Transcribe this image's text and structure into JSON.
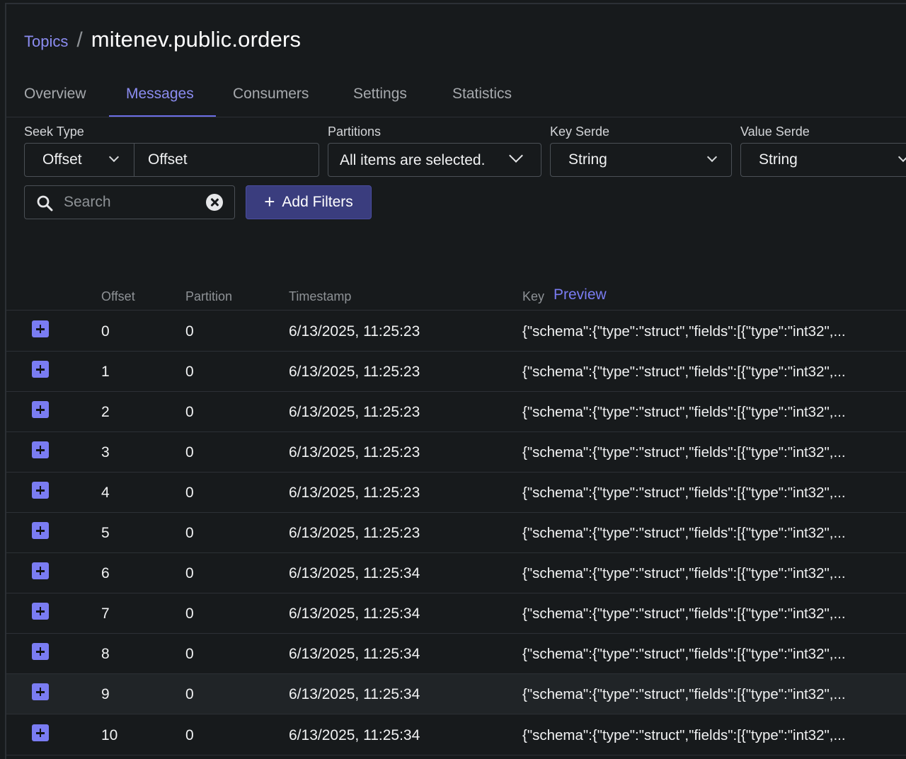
{
  "breadcrumb": {
    "parent": "Topics",
    "separator": "/",
    "current": "mitenev.public.orders"
  },
  "tabs": [
    {
      "label": "Overview"
    },
    {
      "label": "Messages",
      "active": true
    },
    {
      "label": "Consumers"
    },
    {
      "label": "Settings"
    },
    {
      "label": "Statistics"
    }
  ],
  "filters": {
    "seek_type": {
      "label": "Seek Type",
      "value": "Offset",
      "input_placeholder": "Offset"
    },
    "partitions": {
      "label": "Partitions",
      "value": "All items are selected."
    },
    "key_serde": {
      "label": "Key Serde",
      "value": "String"
    },
    "value_serde": {
      "label": "Value Serde",
      "value": "String"
    },
    "search": {
      "placeholder": "Search"
    },
    "add_filters_label": "Add Filters"
  },
  "table": {
    "headers": {
      "offset": "Offset",
      "partition": "Partition",
      "timestamp": "Timestamp",
      "key": "Key",
      "preview": "Preview"
    },
    "rows": [
      {
        "offset": "0",
        "partition": "0",
        "timestamp": "6/13/2025, 11:25:23",
        "key": "{\"schema\":{\"type\":\"struct\",\"fields\":[{\"type\":\"int32\",..."
      },
      {
        "offset": "1",
        "partition": "0",
        "timestamp": "6/13/2025, 11:25:23",
        "key": "{\"schema\":{\"type\":\"struct\",\"fields\":[{\"type\":\"int32\",..."
      },
      {
        "offset": "2",
        "partition": "0",
        "timestamp": "6/13/2025, 11:25:23",
        "key": "{\"schema\":{\"type\":\"struct\",\"fields\":[{\"type\":\"int32\",..."
      },
      {
        "offset": "3",
        "partition": "0",
        "timestamp": "6/13/2025, 11:25:23",
        "key": "{\"schema\":{\"type\":\"struct\",\"fields\":[{\"type\":\"int32\",..."
      },
      {
        "offset": "4",
        "partition": "0",
        "timestamp": "6/13/2025, 11:25:23",
        "key": "{\"schema\":{\"type\":\"struct\",\"fields\":[{\"type\":\"int32\",..."
      },
      {
        "offset": "5",
        "partition": "0",
        "timestamp": "6/13/2025, 11:25:23",
        "key": "{\"schema\":{\"type\":\"struct\",\"fields\":[{\"type\":\"int32\",..."
      },
      {
        "offset": "6",
        "partition": "0",
        "timestamp": "6/13/2025, 11:25:34",
        "key": "{\"schema\":{\"type\":\"struct\",\"fields\":[{\"type\":\"int32\",..."
      },
      {
        "offset": "7",
        "partition": "0",
        "timestamp": "6/13/2025, 11:25:34",
        "key": "{\"schema\":{\"type\":\"struct\",\"fields\":[{\"type\":\"int32\",..."
      },
      {
        "offset": "8",
        "partition": "0",
        "timestamp": "6/13/2025, 11:25:34",
        "key": "{\"schema\":{\"type\":\"struct\",\"fields\":[{\"type\":\"int32\",..."
      },
      {
        "offset": "9",
        "partition": "0",
        "timestamp": "6/13/2025, 11:25:34",
        "key": "{\"schema\":{\"type\":\"struct\",\"fields\":[{\"type\":\"int32\",..."
      },
      {
        "offset": "10",
        "partition": "0",
        "timestamp": "6/13/2025, 11:25:34",
        "key": "{\"schema\":{\"type\":\"struct\",\"fields\":[{\"type\":\"int32\",..."
      }
    ]
  },
  "colors": {
    "accent": "#7a7cf2",
    "background": "#171a1c",
    "button": "#3a3d7e",
    "border": "#2c3035"
  }
}
